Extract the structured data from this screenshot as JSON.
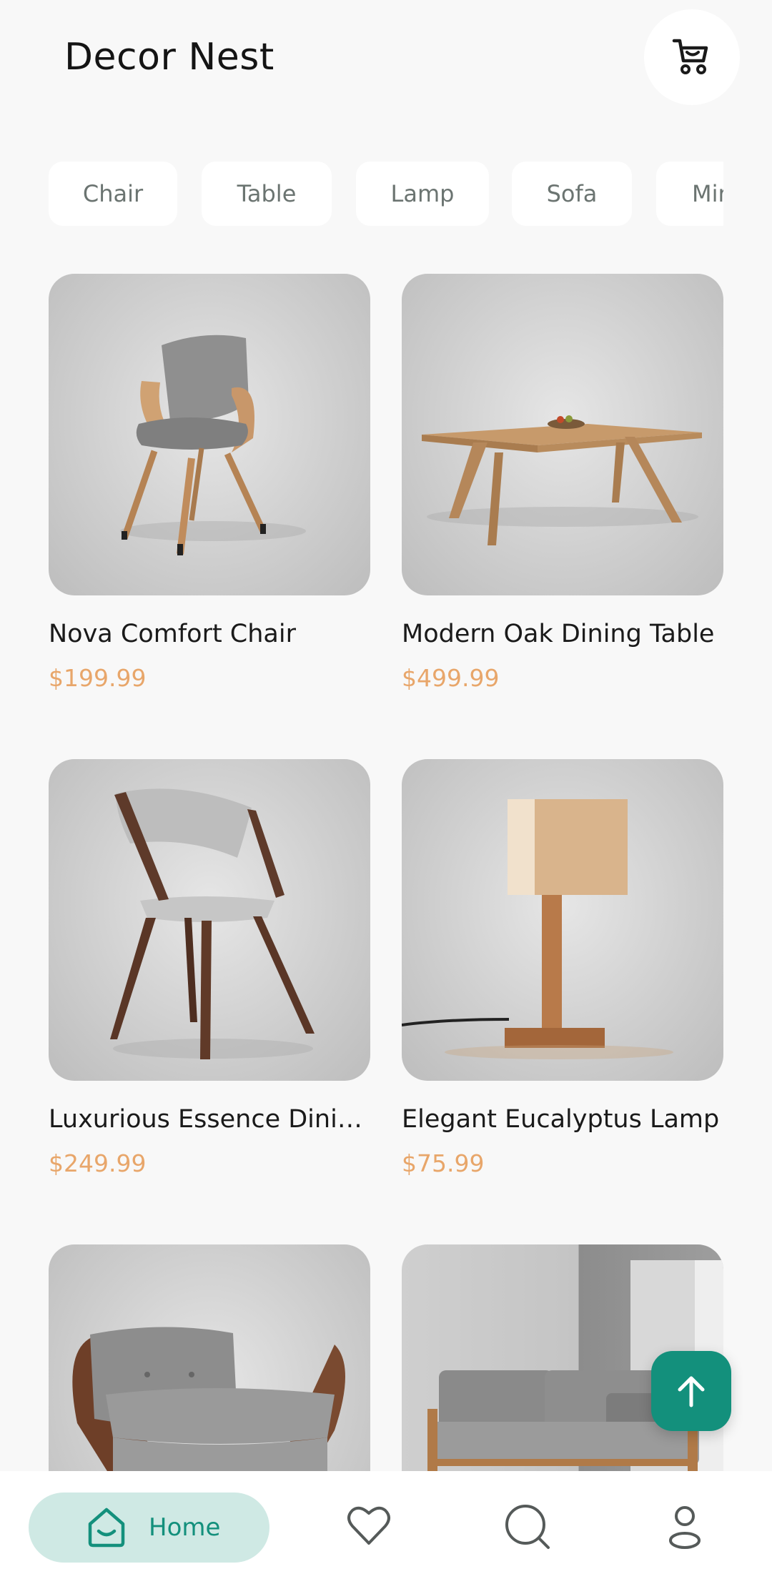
{
  "app": {
    "title": "Decor Nest"
  },
  "header": {
    "cart_icon": "cart-icon"
  },
  "categories": [
    "Chair",
    "Table",
    "Lamp",
    "Sofa",
    "Mirror"
  ],
  "products": [
    {
      "name": "Nova Comfort Chair",
      "price": "$199.99",
      "image": "grey-wood-armchair"
    },
    {
      "name": "Modern Oak Dining Table",
      "price": "$499.99",
      "image": "oak-dining-table"
    },
    {
      "name": "Luxurious Essence Dinin...",
      "price": "$249.99",
      "image": "walnut-dining-chair"
    },
    {
      "name": "Elegant Eucalyptus Lamp",
      "price": "$75.99",
      "image": "wood-table-lamp"
    },
    {
      "name": "",
      "price": "",
      "image": "grey-lounge-armchair"
    },
    {
      "name": "",
      "price": "",
      "image": "grey-wood-sofa"
    }
  ],
  "fab": {
    "icon": "arrow-up-icon"
  },
  "bottom_nav": {
    "home_label": "Home",
    "icons": [
      "home-icon",
      "heart-icon",
      "search-icon",
      "profile-icon"
    ]
  },
  "colors": {
    "accent": "#13907c",
    "accent_light": "#cfe9e4",
    "price": "#e8a66a",
    "background": "#f8f8f8"
  }
}
